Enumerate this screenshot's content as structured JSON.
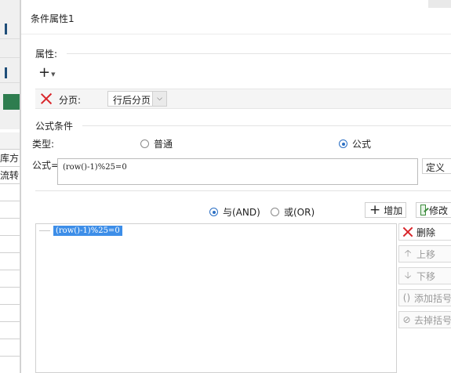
{
  "background_sheet": {
    "cells": [
      "",
      "库方",
      "流转"
    ]
  },
  "dialog": {
    "title": "条件属性1"
  },
  "properties": {
    "section_label": "属性:",
    "page_break_label": "分页:",
    "page_break_value": "行后分页"
  },
  "formula_condition": {
    "section_label": "公式条件",
    "type_label": "类型:",
    "type_options": [
      "普通",
      "公式"
    ],
    "selected_type": "公式",
    "formula_label": "公式=",
    "formula_value": "(row()-1)%25=0",
    "define_button": "定义"
  },
  "logic": {
    "and_label": "与(AND)",
    "or_label": "或(OR)",
    "selected": "与(AND)",
    "add_button": "增加",
    "edit_button": "修改"
  },
  "conditions_list": [
    "(row()-1)%25=0"
  ],
  "side_buttons": {
    "delete": "删除",
    "move_up": "上移",
    "move_down": "下移",
    "add_parens": "添加括号",
    "remove_parens": "去掉括号"
  },
  "colors": {
    "selection": "#3d8ee8",
    "delete_red": "#d9262b",
    "radio_accent": "#2b6fc4"
  }
}
